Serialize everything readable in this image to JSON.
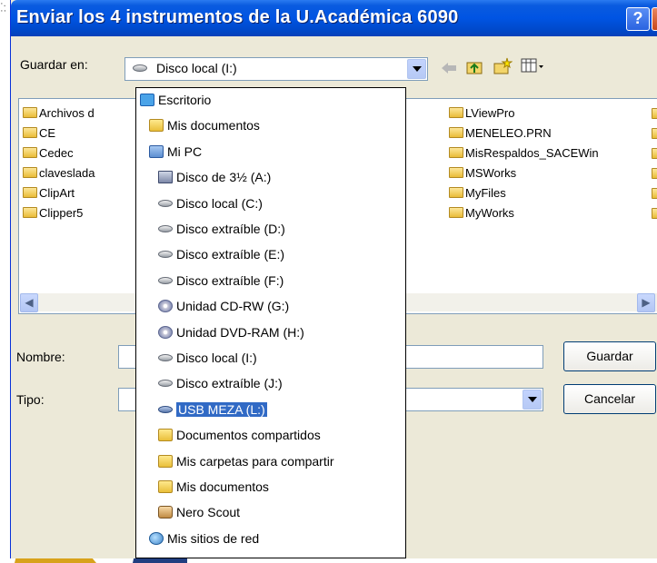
{
  "window": {
    "title": "Enviar los 4 instrumentos de la U.Académica 6090",
    "help_label": "?"
  },
  "toolbar": {
    "save_in_label": "Guardar en:",
    "save_in_value": "Disco local (I:)"
  },
  "files": {
    "col1": [
      "Archivos d",
      "CE",
      "Cedec",
      "clavesladа",
      "ClipArt",
      "Clipper5"
    ],
    "col2": [
      "LViewPro",
      "MENELEO.PRN",
      "MisRespaldos_SACEWin",
      "MSWorks",
      "MyFiles",
      "MyWorks"
    ]
  },
  "form": {
    "name_label": "Nombre:",
    "type_label": "Tipo:",
    "save_button": "Guardar",
    "cancel_button": "Cancelar"
  },
  "dropdown": {
    "items": [
      {
        "label": "Escritorio",
        "icon": "desktop-icon"
      },
      {
        "label": "Mis documentos",
        "icon": "my-documents-icon"
      },
      {
        "label": "Mi PC",
        "icon": "my-computer-icon"
      },
      {
        "label": "Disco de 3½ (A:)",
        "icon": "floppy-icon"
      },
      {
        "label": "Disco local (C:)",
        "icon": "hard-drive-icon"
      },
      {
        "label": "Disco extraíble (D:)",
        "icon": "removable-drive-icon"
      },
      {
        "label": "Disco extraíble (E:)",
        "icon": "removable-drive-icon"
      },
      {
        "label": "Disco extraíble (F:)",
        "icon": "removable-drive-icon"
      },
      {
        "label": "Unidad CD-RW (G:)",
        "icon": "cd-drive-icon"
      },
      {
        "label": "Unidad DVD-RAM (H:)",
        "icon": "dvd-drive-icon"
      },
      {
        "label": "Disco local (I:)",
        "icon": "hard-drive-icon"
      },
      {
        "label": "Disco extraíble (J:)",
        "icon": "removable-drive-icon"
      },
      {
        "label": "USB MEZA (L:)",
        "icon": "usb-drive-icon",
        "selected": true
      },
      {
        "label": "Documentos compartidos",
        "icon": "shared-documents-icon"
      },
      {
        "label": "Mis carpetas para compartir",
        "icon": "shared-folders-icon"
      },
      {
        "label": "Mis documentos",
        "icon": "folder-icon"
      },
      {
        "label": "Nero Scout",
        "icon": "nero-scout-icon"
      },
      {
        "label": "Mis sitios de red",
        "icon": "network-places-icon"
      }
    ]
  }
}
